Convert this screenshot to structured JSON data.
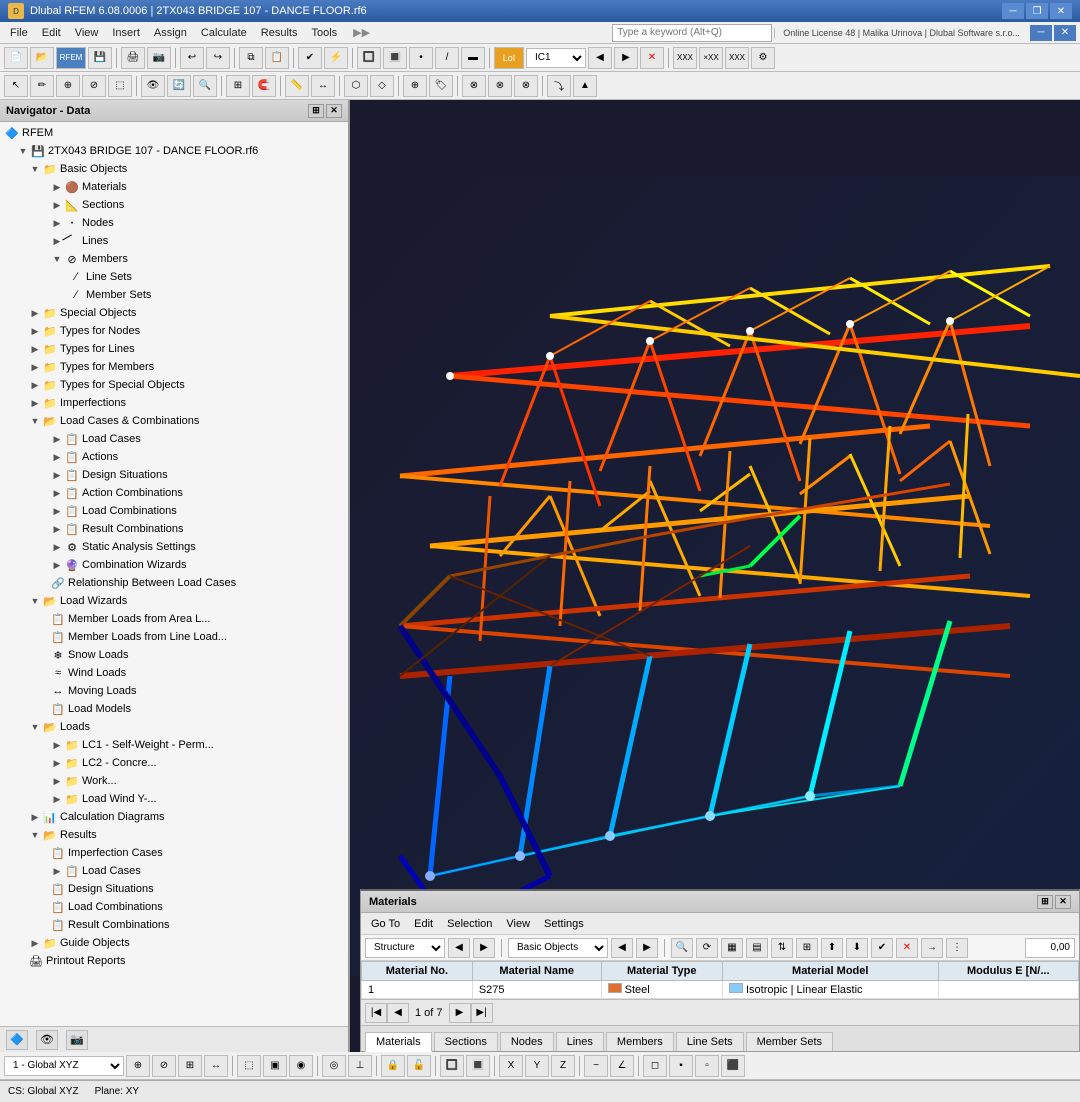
{
  "titleBar": {
    "icon": "D",
    "title": "Dlubal RFEM 6.08.0006 | 2TX043 BRIDGE 107 - DANCE FLOOR.rf6",
    "controls": [
      "minimize",
      "restore",
      "close"
    ]
  },
  "menuBar": {
    "items": [
      "File",
      "Edit",
      "View",
      "Insert",
      "Assign",
      "Calculate",
      "Results",
      "Tools"
    ],
    "searchPlaceholder": "Type a keyword (Alt+Q)",
    "onlineInfo": "Online License 48 | Malika Urinova | Dlubal Software s.r.o..."
  },
  "navigator": {
    "title": "Navigator - Data",
    "rfem": "RFEM",
    "project": "2TX043 BRIDGE 107 - DANCE FLOOR.rf6",
    "tree": [
      {
        "id": "basic-objects",
        "label": "Basic Objects",
        "level": 1,
        "icon": "📁",
        "expanded": true
      },
      {
        "id": "materials",
        "label": "Materials",
        "level": 2,
        "icon": "🟤"
      },
      {
        "id": "sections",
        "label": "Sections",
        "level": 2,
        "icon": "📐"
      },
      {
        "id": "nodes",
        "label": "Nodes",
        "level": 2,
        "icon": "•"
      },
      {
        "id": "lines",
        "label": "Lines",
        "level": 2,
        "icon": "/"
      },
      {
        "id": "members",
        "label": "Members",
        "level": 2,
        "icon": "⊘",
        "expanded": true
      },
      {
        "id": "line-sets",
        "label": "Line Sets",
        "level": 3,
        "icon": "/"
      },
      {
        "id": "member-sets",
        "label": "Member Sets",
        "level": 3,
        "icon": "/"
      },
      {
        "id": "special-objects",
        "label": "Special Objects",
        "level": 1,
        "icon": "📁"
      },
      {
        "id": "types-for-nodes",
        "label": "Types for Nodes",
        "level": 1,
        "icon": "📁"
      },
      {
        "id": "types-for-lines",
        "label": "Types for Lines",
        "level": 1,
        "icon": "📁"
      },
      {
        "id": "types-for-members",
        "label": "Types for Members",
        "level": 1,
        "icon": "📁"
      },
      {
        "id": "types-for-special-objects",
        "label": "Types for Special Objects",
        "level": 1,
        "icon": "📁"
      },
      {
        "id": "imperfections",
        "label": "Imperfections",
        "level": 1,
        "icon": "📁"
      },
      {
        "id": "load-cases-combinations",
        "label": "Load Cases & Combinations",
        "level": 1,
        "icon": "📂",
        "expanded": true
      },
      {
        "id": "load-cases",
        "label": "Load Cases",
        "level": 2,
        "icon": "📋"
      },
      {
        "id": "actions",
        "label": "Actions",
        "level": 2,
        "icon": "📋"
      },
      {
        "id": "design-situations",
        "label": "Design Situations",
        "level": 2,
        "icon": "📋"
      },
      {
        "id": "action-combinations",
        "label": "Action Combinations",
        "level": 2,
        "icon": "📋"
      },
      {
        "id": "load-combinations",
        "label": "Load Combinations",
        "level": 2,
        "icon": "📋"
      },
      {
        "id": "result-combinations",
        "label": "Result Combinations",
        "level": 2,
        "icon": "📋"
      },
      {
        "id": "static-analysis-settings",
        "label": "Static Analysis Settings",
        "level": 2,
        "icon": "⚙"
      },
      {
        "id": "combination-wizards",
        "label": "Combination Wizards",
        "level": 2,
        "icon": "🧙"
      },
      {
        "id": "relationship-load-cases",
        "label": "Relationship Between Load Cases",
        "level": 2,
        "icon": "🔗"
      },
      {
        "id": "load-wizards",
        "label": "Load Wizards",
        "level": 1,
        "icon": "📂",
        "expanded": true
      },
      {
        "id": "member-loads-area",
        "label": "Member Loads from Area L...",
        "level": 2,
        "icon": "📋"
      },
      {
        "id": "member-loads-line",
        "label": "Member Loads from Line Load...",
        "level": 2,
        "icon": "📋"
      },
      {
        "id": "snow-loads",
        "label": "Snow Loads",
        "level": 2,
        "icon": "❄"
      },
      {
        "id": "wind-loads",
        "label": "Wind Loads",
        "level": 2,
        "icon": "🌬"
      },
      {
        "id": "moving-loads",
        "label": "Moving Loads",
        "level": 2,
        "icon": "🔄"
      },
      {
        "id": "load-models",
        "label": "Load Models",
        "level": 2,
        "icon": "📋"
      },
      {
        "id": "loads",
        "label": "Loads",
        "level": 1,
        "icon": "📂",
        "expanded": true
      },
      {
        "id": "lc1",
        "label": "LC1 - Self-Weight - Perm...",
        "level": 2,
        "icon": "📁"
      },
      {
        "id": "lc2",
        "label": "LC2 - Concre...",
        "level": 2,
        "icon": "📁"
      },
      {
        "id": "lc3",
        "label": "Work...",
        "level": 2,
        "icon": "📁"
      },
      {
        "id": "lc-wind",
        "label": "Load Wind Y-...",
        "level": 2,
        "icon": "📁"
      },
      {
        "id": "calculation-diagrams",
        "label": "Calculation Diagrams",
        "level": 1,
        "icon": "📊"
      },
      {
        "id": "results",
        "label": "Results",
        "level": 1,
        "icon": "📂",
        "expanded": true
      },
      {
        "id": "imperfection-cases",
        "label": "Imperfection Cases",
        "level": 2,
        "icon": "📋"
      },
      {
        "id": "results-load-cases",
        "label": "Load Cases",
        "level": 2,
        "icon": "📋"
      },
      {
        "id": "results-design-situations",
        "label": "Design Situations",
        "level": 2,
        "icon": "📋"
      },
      {
        "id": "results-load-combinations",
        "label": "Load Combinations",
        "level": 2,
        "icon": "📋"
      },
      {
        "id": "results-result-combinations",
        "label": "Result Combinations",
        "level": 2,
        "icon": "📋"
      },
      {
        "id": "guide-objects",
        "label": "Guide Objects",
        "level": 1,
        "icon": "📁"
      },
      {
        "id": "printout-reports",
        "label": "Printout Reports",
        "level": 1,
        "icon": "🖨"
      }
    ]
  },
  "materialsPanel": {
    "title": "Materials",
    "menuItems": [
      "Go To",
      "Edit",
      "Selection",
      "View",
      "Settings"
    ],
    "toolbar": {
      "filterLabel": "Structure",
      "categoryLabel": "Basic Objects"
    },
    "tableHeaders": [
      "Material No.",
      "Material Name",
      "Material Type",
      "Material Model",
      "Modulus E [N/..."
    ],
    "tableRows": [
      {
        "no": "1",
        "name": "S275",
        "type": "Steel",
        "model": "Isotropic | Linear Elastic",
        "color": "#e07030"
      }
    ],
    "tabs": [
      "Materials",
      "Sections",
      "Nodes",
      "Lines",
      "Members",
      "Line Sets",
      "Member Sets"
    ],
    "activeTab": "Materials",
    "pagination": "1 of 7"
  },
  "statusBar": {
    "cs": "CS: Global XYZ",
    "plane": "Plane: XY"
  },
  "bottomCombo": "1 - Global XYZ"
}
